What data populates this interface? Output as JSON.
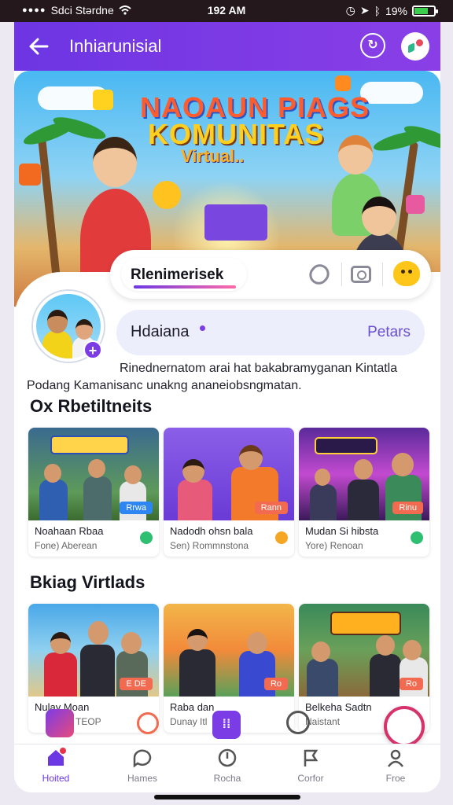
{
  "status_bar": {
    "carrier": "Sdci Stərdne",
    "time": "192 AM",
    "battery": "19%",
    "battery_level": 0.7
  },
  "app_bar": {
    "title": "Inhiarunisial",
    "back_icon": "back-arrow-icon",
    "action_icon_1": "clock-edit-icon",
    "action_icon_2": "app-logo-icon",
    "accent": "#7b3ce6"
  },
  "banner": {
    "line1": "NAOAUN PIAGS",
    "line2": "KOMUNITAS",
    "line3": "Virtual.."
  },
  "profile_tabs": {
    "active_tab": "Rlenimerisek",
    "icons": [
      "paperclip-icon",
      "camera-icon",
      "emoji-icon"
    ]
  },
  "search": {
    "value": "Hdaiana",
    "action": "Petars"
  },
  "description": {
    "line1": "Rinednernatom arai hat bakabramyganan Kintatla",
    "line2": "Podang Kamanisanc unakng ananeiobsngmatan."
  },
  "sections": [
    {
      "title": "Ox Rbetiltneits",
      "tiles": [
        {
          "title": "Noahaan Rbaa",
          "subtitle": "Fone) Aberean",
          "badge": "Rrwa",
          "badge_color": "#2e86f3",
          "icon_color": "#2fbf71"
        },
        {
          "title": "Nadodh ohsn bala",
          "subtitle": "Sen) Rommnstona",
          "badge": "Rann",
          "badge_color": "#f26a4f",
          "icon_color": "#f5a623"
        },
        {
          "title": "Mudan Si hibsta",
          "subtitle": "Yore) Renoan",
          "badge": "Rinu",
          "badge_color": "#f26a4f",
          "icon_color": "#2fbf71"
        }
      ]
    },
    {
      "title": "Bkiag Virtlads",
      "tiles": [
        {
          "title": "Nulay Moan",
          "subtitle": "TEOP",
          "badge": "E DE",
          "badge_color": "#f26a4f",
          "icon_color": "#f26a4f"
        },
        {
          "title": "Raba dan",
          "subtitle": "Dunay Itl",
          "badge": "Ro",
          "badge_color": "#f26a4f",
          "icon_color": "#7b3ce6"
        },
        {
          "title": "Belkeha Sadtn",
          "subtitle": "Naistant",
          "badge": "Ro",
          "badge_color": "#f26a4f",
          "icon_color": "#7b3ce6"
        }
      ]
    }
  ],
  "bottom_nav": [
    {
      "label": "Hoited",
      "icon": "home-icon",
      "active": true
    },
    {
      "label": "Hames",
      "icon": "chat-icon",
      "active": false
    },
    {
      "label": "Rocha",
      "icon": "compass-icon",
      "active": false
    },
    {
      "label": "Corfor",
      "icon": "flag-icon",
      "active": false
    },
    {
      "label": "Froe",
      "icon": "profile-icon",
      "active": false
    }
  ]
}
